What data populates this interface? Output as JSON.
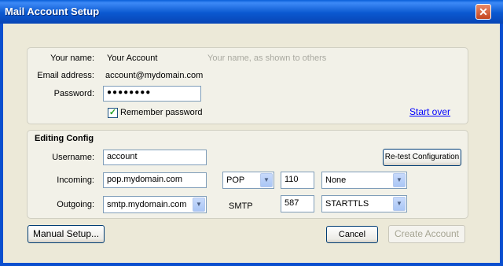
{
  "window": {
    "title": "Mail Account Setup",
    "close_glyph": "✕"
  },
  "account": {
    "name_label": "Your name:",
    "name_value": "Your Account",
    "name_hint": "Your name, as shown to others",
    "email_label": "Email address:",
    "email_value": "account@mydomain.com",
    "password_label": "Password:",
    "password_value": "●●●●●●●●",
    "remember_label": "Remember password",
    "remember_checked": true,
    "start_over": "Start over"
  },
  "config": {
    "heading": "Editing Config",
    "username_label": "Username:",
    "username_value": "account",
    "retest_button": "Re-test Configuration",
    "incoming_label": "Incoming:",
    "incoming_server": "pop.mydomain.com",
    "incoming_protocol": "POP",
    "incoming_port": "110",
    "incoming_security": "None",
    "outgoing_label": "Outgoing:",
    "outgoing_server": "smtp.mydomain.com",
    "outgoing_protocol": "SMTP",
    "outgoing_port": "587",
    "outgoing_security": "STARTTLS"
  },
  "footer": {
    "manual_setup": "Manual Setup...",
    "cancel": "Cancel",
    "create_account": "Create Account"
  },
  "icons": {
    "dropdown": "chevron-down-icon",
    "check": "checkmark-icon",
    "close": "close-icon"
  }
}
